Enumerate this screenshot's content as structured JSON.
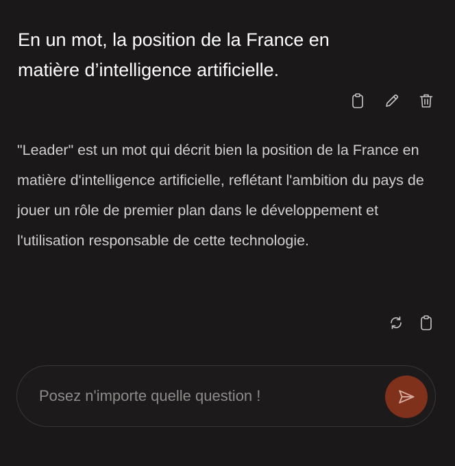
{
  "conversation": {
    "user_message": "En un mot, la position de la France en matière d’intelligence artificielle.",
    "assistant_message": "\"Leader\" est un mot qui décrit bien la position de la France en matière d'intelligence artificielle, reflétant l'ambition du pays de jouer un rôle de premier plan dans le développement et l'utilisation responsable de cette technologie."
  },
  "message_actions": [
    "clipboard-icon",
    "pencil-icon",
    "trash-icon"
  ],
  "reply_actions": [
    "refresh-icon",
    "clipboard-icon"
  ],
  "composer": {
    "placeholder": "Posez n'importe quelle question !",
    "value": ""
  },
  "colors": {
    "background": "#1b1819",
    "user_text": "#ffffff",
    "assistant_text": "#d2cfcf",
    "icon": "#c9c6c6",
    "placeholder": "#8f8b8b",
    "send_button": "#80311c",
    "send_icon": "#d7a99b"
  }
}
